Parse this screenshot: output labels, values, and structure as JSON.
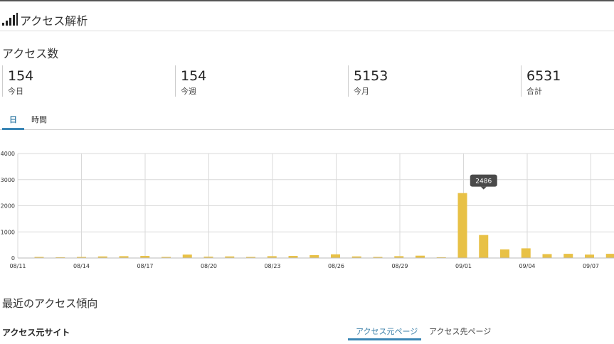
{
  "header": {
    "title": "アクセス解析",
    "icon": "signal-bars-icon"
  },
  "access_count": {
    "title": "アクセス数",
    "stats": [
      {
        "value": "154",
        "label": "今日"
      },
      {
        "value": "154",
        "label": "今週"
      },
      {
        "value": "5153",
        "label": "今月"
      },
      {
        "value": "6531",
        "label": "合計"
      }
    ]
  },
  "tabs": [
    {
      "label": "日",
      "active": true
    },
    {
      "label": "時間",
      "active": false
    }
  ],
  "chart_data": {
    "type": "bar",
    "x_tick_labels": [
      "08/11",
      "08/14",
      "08/17",
      "08/20",
      "08/23",
      "08/26",
      "08/29",
      "09/01",
      "09/04",
      "09/07"
    ],
    "y_ticks": [
      0,
      1000,
      2000,
      3000,
      4000
    ],
    "ylim": [
      0,
      4000
    ],
    "grid": true,
    "categories": [
      "08/11",
      "08/12",
      "08/13",
      "08/14",
      "08/15",
      "08/16",
      "08/17",
      "08/18",
      "08/19",
      "08/20",
      "08/21",
      "08/22",
      "08/23",
      "08/24",
      "08/25",
      "08/26",
      "08/27",
      "08/28",
      "08/29",
      "08/30",
      "08/31",
      "09/01",
      "09/02",
      "09/03",
      "09/04",
      "09/05",
      "09/06",
      "09/07",
      "09/08"
    ],
    "values": [
      40,
      30,
      40,
      60,
      70,
      80,
      40,
      130,
      50,
      60,
      40,
      70,
      80,
      110,
      140,
      60,
      40,
      70,
      90,
      30,
      2486,
      880,
      330,
      370,
      150,
      160,
      130,
      160,
      154
    ],
    "tooltip": {
      "category": "09/01",
      "value": "2486"
    },
    "bar_color": "#e8c146"
  },
  "trend": {
    "title": "最近のアクセス傾向",
    "source_label": "アクセス元サイト",
    "tabs": [
      {
        "label": "アクセス元ページ",
        "active": true
      },
      {
        "label": "アクセス先ページ",
        "active": false
      }
    ]
  }
}
